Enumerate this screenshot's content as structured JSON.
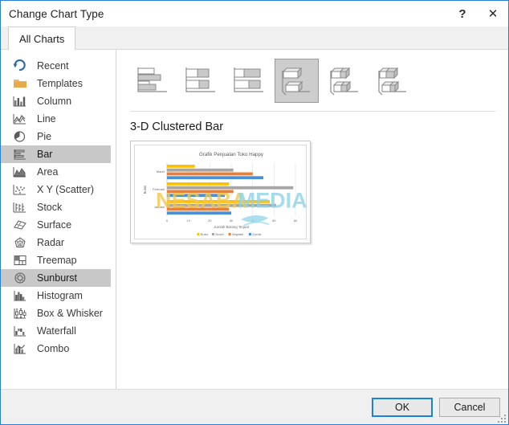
{
  "window": {
    "title": "Change Chart Type",
    "help_label": "?",
    "close_label": "✕"
  },
  "tabs": [
    {
      "label": "All Charts",
      "active": true
    }
  ],
  "sidebar": {
    "items": [
      {
        "label": "Recent",
        "icon": "recent-icon",
        "selected": false
      },
      {
        "label": "Templates",
        "icon": "folder-icon",
        "selected": false
      },
      {
        "label": "Column",
        "icon": "column-icon",
        "selected": false
      },
      {
        "label": "Line",
        "icon": "line-icon",
        "selected": false
      },
      {
        "label": "Pie",
        "icon": "pie-icon",
        "selected": false
      },
      {
        "label": "Bar",
        "icon": "bar-icon",
        "selected": true
      },
      {
        "label": "Area",
        "icon": "area-icon",
        "selected": false
      },
      {
        "label": "X Y (Scatter)",
        "icon": "scatter-icon",
        "selected": false
      },
      {
        "label": "Stock",
        "icon": "stock-icon",
        "selected": false
      },
      {
        "label": "Surface",
        "icon": "surface-icon",
        "selected": false
      },
      {
        "label": "Radar",
        "icon": "radar-icon",
        "selected": false
      },
      {
        "label": "Treemap",
        "icon": "treemap-icon",
        "selected": false
      },
      {
        "label": "Sunburst",
        "icon": "sunburst-icon",
        "selected": true
      },
      {
        "label": "Histogram",
        "icon": "histogram-icon",
        "selected": false
      },
      {
        "label": "Box & Whisker",
        "icon": "box-whisker-icon",
        "selected": false
      },
      {
        "label": "Waterfall",
        "icon": "waterfall-icon",
        "selected": false
      },
      {
        "label": "Combo",
        "icon": "combo-icon",
        "selected": false
      }
    ]
  },
  "gallery": {
    "thumbnails": [
      {
        "name": "clustered-bar",
        "selected": false,
        "style": "2d-clustered"
      },
      {
        "name": "stacked-bar",
        "selected": false,
        "style": "2d-stacked"
      },
      {
        "name": "100-stacked-bar",
        "selected": false,
        "style": "2d-100-stacked"
      },
      {
        "name": "3d-clustered-bar",
        "selected": true,
        "style": "3d-clustered"
      },
      {
        "name": "3d-stacked-bar",
        "selected": false,
        "style": "3d-stacked"
      },
      {
        "name": "3d-100-stacked-bar",
        "selected": false,
        "style": "3d-100-stacked"
      }
    ],
    "preview_title": "3-D Clustered Bar"
  },
  "watermark": {
    "text_primary": "NESABA",
    "text_secondary": "MEDIA",
    "color": "#f2c94c",
    "color_secondary": "#8fd4e8"
  },
  "footer": {
    "ok_label": "OK",
    "cancel_label": "Cancel"
  },
  "chart_data": {
    "type": "bar",
    "orientation": "horizontal",
    "title": "Grafik Penjualan Toko Happy",
    "xlabel": "Jumlah Barang Terjual",
    "ylabel": "Bulan",
    "categories": [
      "Januari",
      "Februari",
      "Maret"
    ],
    "category_order_top_to_bottom": [
      "Maret",
      "Februari",
      "Januari"
    ],
    "xlim": [
      0,
      60
    ],
    "xticks": [
      0,
      10,
      20,
      30,
      40,
      50,
      60
    ],
    "grid": true,
    "legend_position": "bottom",
    "series": [
      {
        "name": "Komik",
        "color": "#4a90d9",
        "values": [
          30,
          27,
          45
        ]
      },
      {
        "name": "Majalah",
        "color": "#ed7d31",
        "values": [
          29,
          31,
          40
        ]
      },
      {
        "name": "Novel",
        "color": "#a5a5a5",
        "values": [
          51,
          59,
          31
        ]
      },
      {
        "name": "Buku",
        "color": "#ffc000",
        "values": [
          48,
          29,
          13
        ]
      }
    ]
  }
}
